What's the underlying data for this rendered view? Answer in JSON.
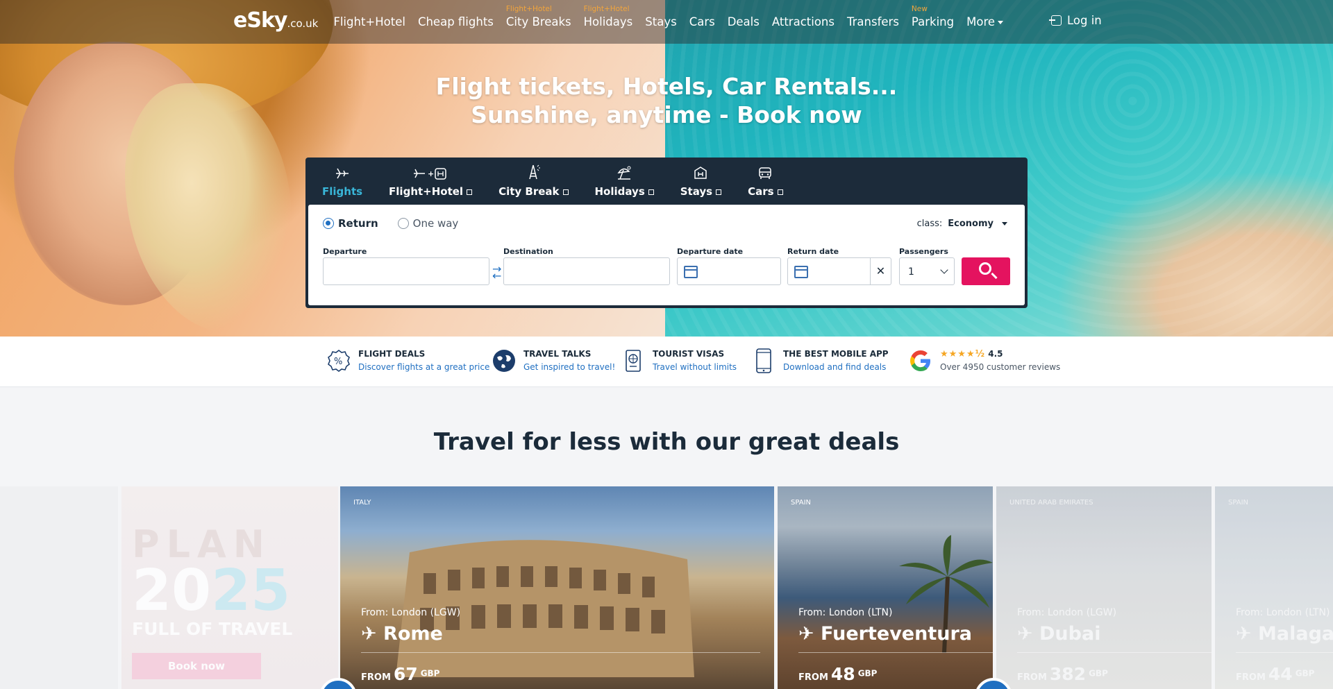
{
  "header": {
    "logo": "eSky",
    "logo_suffix": ".co.uk",
    "nav": [
      {
        "label": "Flight+Hotel",
        "tag": ""
      },
      {
        "label": "Cheap flights",
        "tag": ""
      },
      {
        "label": "City Breaks",
        "tag": "Flight+Hotel"
      },
      {
        "label": "Holidays",
        "tag": "Flight+Hotel"
      },
      {
        "label": "Stays",
        "tag": ""
      },
      {
        "label": "Cars",
        "tag": ""
      },
      {
        "label": "Deals",
        "tag": ""
      },
      {
        "label": "Attractions",
        "tag": ""
      },
      {
        "label": "Transfers",
        "tag": ""
      },
      {
        "label": "Parking",
        "tag": "New"
      },
      {
        "label": "More",
        "tag": ""
      }
    ],
    "login": "Log in"
  },
  "hero": {
    "title_line1": "Flight tickets, Hotels, Car Rentals...",
    "title_line2": "Sunshine, anytime - Book now"
  },
  "search": {
    "tabs": [
      {
        "label": "Flights",
        "icon": "plane-icon"
      },
      {
        "label": "Flight+Hotel",
        "icon": "plane-hotel-icon"
      },
      {
        "label": "City Break",
        "icon": "eiffel-tower-icon"
      },
      {
        "label": "Holidays",
        "icon": "beach-umbrella-icon"
      },
      {
        "label": "Stays",
        "icon": "hotel-icon"
      },
      {
        "label": "Cars",
        "icon": "car-icon"
      }
    ],
    "trip_types": [
      "Return",
      "One way"
    ],
    "class_label": "class:",
    "class_value": "Economy",
    "departure_label": "Departure",
    "destination_label": "Destination",
    "departure_date_label": "Departure date",
    "return_date_label": "Return date",
    "passengers_label": "Passengers",
    "passengers_value": "1",
    "departure_value": "",
    "destination_value": "",
    "clear": "✕"
  },
  "features": [
    {
      "title": "FLIGHT DEALS",
      "sub": "Discover flights at a great price",
      "icon": "percent-badge-icon"
    },
    {
      "title": "TRAVEL TALKS",
      "sub": "Get inspired to travel!",
      "icon": "globe-icon"
    },
    {
      "title": "TOURIST VISAS",
      "sub": "Travel without limits",
      "icon": "passport-icon"
    },
    {
      "title": "THE BEST MOBILE APP",
      "sub": "Download and find deals",
      "icon": "smartphone-icon"
    }
  ],
  "reviews": {
    "stars": "★★★★½",
    "rating": "4.5",
    "text": "Over 4950 customer reviews",
    "icon": "google-icon"
  },
  "deals": {
    "title": "Travel for less with our great deals",
    "plan": {
      "line1": "PLAN",
      "year_a": "20",
      "year_b": "25",
      "line3": "FULL OF TRAVEL",
      "button": "Book now"
    },
    "cards": [
      {
        "country": "ITALY",
        "from": "From: London (LGW)",
        "city": "✈ Rome",
        "from_label": "FROM",
        "price": "67",
        "currency": "GBP"
      },
      {
        "country": "SPAIN",
        "from": "From: London (LTN)",
        "city": "✈ Fuerteventura",
        "from_label": "FROM",
        "price": "48",
        "currency": "GBP"
      },
      {
        "country": "UNITED ARAB EMIRATES",
        "from": "From: London (LGW)",
        "city": "✈ Dubai",
        "from_label": "FROM",
        "price": "382",
        "currency": "GBP"
      },
      {
        "country": "SPAIN",
        "from": "From: London (LTN)",
        "city": "✈ Malaga",
        "from_label": "FROM",
        "price": "44",
        "currency": "GBP"
      }
    ]
  },
  "colors": {
    "accent": "#e4135f",
    "brand_blue": "#1f6fc1",
    "dark": "#1c2b3a",
    "tab_active": "#39b6d8",
    "tag": "#f3a53b"
  }
}
